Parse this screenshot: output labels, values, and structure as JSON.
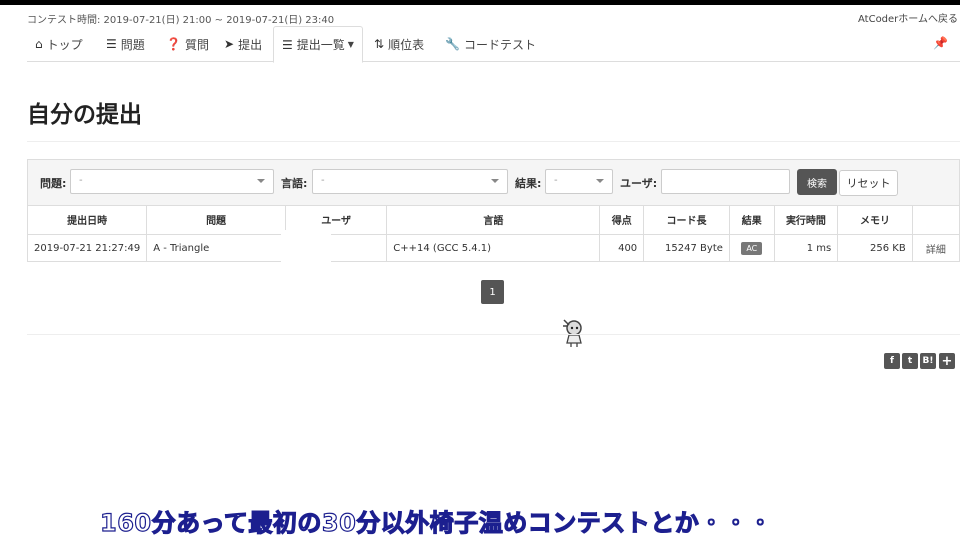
{
  "header": {
    "contest_time": "コンテスト時間: 2019-07-21(日) 21:00 ~ 2019-07-21(日) 23:40",
    "home_link": "AtCoderホームへ戻る"
  },
  "nav": {
    "items": [
      {
        "icon": "home-icon",
        "label": "トップ"
      },
      {
        "icon": "list-icon",
        "label": "問題"
      },
      {
        "icon": "question-icon",
        "label": "質問"
      },
      {
        "icon": "send-icon",
        "label": "提出"
      },
      {
        "icon": "list-icon",
        "label": "提出一覧"
      },
      {
        "icon": "sort-icon",
        "label": "順位表"
      },
      {
        "icon": "wrench-icon",
        "label": "コードテスト"
      }
    ],
    "active_index": 4
  },
  "page": {
    "title": "自分の提出"
  },
  "filters": {
    "problem_label": "問題:",
    "problem_value": "-",
    "language_label": "言語:",
    "language_value": "-",
    "result_label": "結果:",
    "result_value": "-",
    "user_label": "ユーザ:",
    "user_value": "",
    "search_button": "検索",
    "reset_button": "リセット"
  },
  "table": {
    "headers": [
      "提出日時",
      "問題",
      "ユーザ",
      "言語",
      "得点",
      "コード長",
      "結果",
      "実行時間",
      "メモリ",
      ""
    ],
    "rows": [
      {
        "submitted_at": "2019-07-21 21:27:49",
        "problem": "A - Triangle",
        "user": "",
        "language": "C++14 (GCC 5.4.1)",
        "score": "400",
        "code_length": "15247 Byte",
        "result": "AC",
        "exec_time": "1 ms",
        "memory": "256 KB",
        "detail": "詳細"
      }
    ]
  },
  "pagination": {
    "current": "1"
  },
  "share": [
    "f",
    "t",
    "B!",
    "+"
  ],
  "caption": "160分あって最初の30分以外椅子温めコンテストとか・・・"
}
